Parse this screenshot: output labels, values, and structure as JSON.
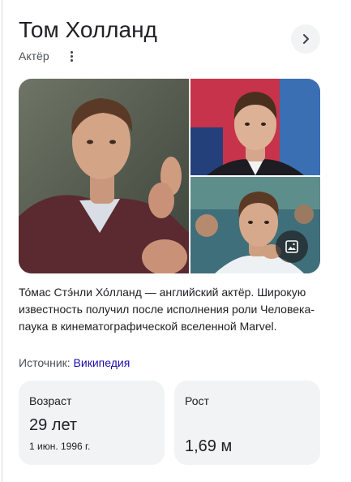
{
  "header": {
    "title": "Том Холланд",
    "subtitle": "Актёр",
    "more_icon": "more-vert-icon",
    "next_icon": "chevron-right-icon"
  },
  "gallery": {
    "images_icon": "image-icon"
  },
  "description": "То́мас Стэ́нли Хо́лланд — английский актёр. Широкую известность получил после исполнения роли Человека-паука в кинематографической вселенной Marvel.",
  "source": {
    "label": "Источник:",
    "link_text": "Википедия",
    "link_color": "#1a0dab"
  },
  "facts": {
    "age": {
      "label": "Возраст",
      "value": "29 лет",
      "sub": "1 июн. 1996 г."
    },
    "height": {
      "label": "Рост",
      "value": "1,69 м"
    }
  },
  "colors": {
    "card_bg": "#f1f3f4",
    "text": "#202124",
    "muted": "#4d5156"
  }
}
